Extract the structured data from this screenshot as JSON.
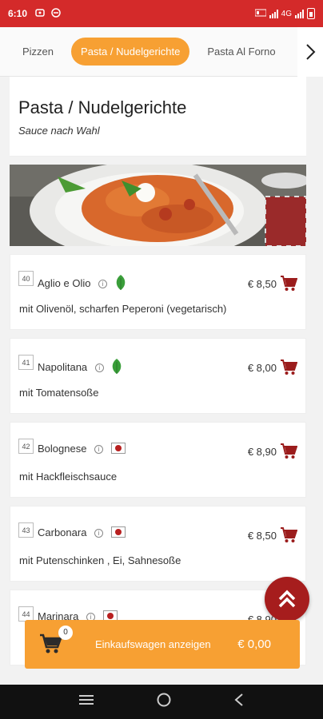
{
  "status": {
    "time": "6:10",
    "network": "4G"
  },
  "categories": [
    "Pizzen",
    "Pasta / Nudelgerichte",
    "Pasta Al Forno"
  ],
  "section": {
    "title": "Pasta / Nudelgerichte",
    "subtitle": "Sauce nach Wahl"
  },
  "items": [
    {
      "num": "40",
      "name": "Aglio e Olio",
      "price": "€ 8,50",
      "desc": "mit Olivenöl, scharfen Peperoni (vegetarisch)",
      "tag": "leaf-icon"
    },
    {
      "num": "41",
      "name": "Napolitana",
      "price": "€ 8,00",
      "desc": "mit Tomatensoße",
      "tag": "leaf-icon"
    },
    {
      "num": "42",
      "name": "Bolognese",
      "price": "€ 8,90",
      "desc": "mit Hackfleischsauce",
      "tag": "meat-icon"
    },
    {
      "num": "43",
      "name": "Carbonara",
      "price": "€ 8,50",
      "desc": "mit Putenschinken , Ei, Sahnesoße",
      "tag": "meat-icon"
    },
    {
      "num": "44",
      "name": "Marinara",
      "price": "€ 8,90",
      "desc": "",
      "tag": "meat-icon"
    }
  ],
  "cart": {
    "count": "0",
    "label": "Einkaufswagen anzeigen",
    "total": "€ 0,00"
  },
  "colors": {
    "statusbar": "#d42a2a",
    "accent": "#f7a033",
    "cart_icon": "#9b1c1c"
  }
}
